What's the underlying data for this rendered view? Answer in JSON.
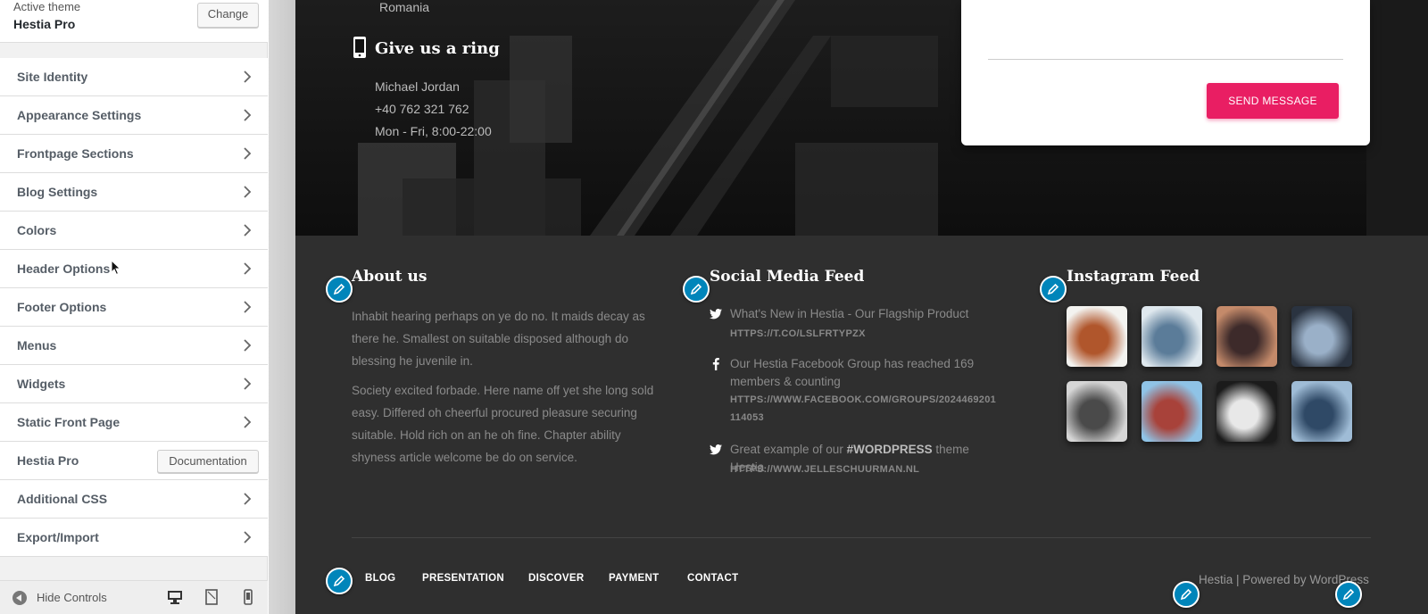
{
  "sidebar": {
    "active_theme_label": "Active theme",
    "active_theme_name": "Hestia Pro",
    "change_label": "Change",
    "items": [
      {
        "label": "Site Identity"
      },
      {
        "label": "Appearance Settings"
      },
      {
        "label": "Frontpage Sections"
      },
      {
        "label": "Blog Settings"
      },
      {
        "label": "Colors"
      },
      {
        "label": "Header Options"
      },
      {
        "label": "Footer Options"
      },
      {
        "label": "Menus"
      },
      {
        "label": "Widgets"
      },
      {
        "label": "Static Front Page"
      },
      {
        "label": "Hestia Pro",
        "button": "Documentation"
      },
      {
        "label": "Additional CSS"
      },
      {
        "label": "Export/Import"
      }
    ],
    "hide_controls_label": "Hide Controls",
    "devices": [
      "desktop-icon",
      "tablet-icon",
      "mobile-icon"
    ]
  },
  "hero": {
    "address_line": "Romania",
    "ring_title": "Give us a ring",
    "contact_name": "Michael Jordan",
    "contact_phone": "+40 762 321 762",
    "contact_hours": "Mon - Fri, 8:00-22:00",
    "send_label": "SEND MESSAGE"
  },
  "footer": {
    "about": {
      "title": "About us",
      "p1": "Inhabit hearing perhaps on ye do no. It maids decay as there he. Smallest on suitable disposed although do blessing he juvenile in.",
      "p2": "Society excited forbade. Here name off yet she long sold easy. Differed oh cheerful procured pleasure securing suitable. Hold rich on an he oh fine. Chapter ability shyness article welcome be do on service."
    },
    "social": {
      "title": "Social Media Feed",
      "items": [
        {
          "icon": "twitter-icon",
          "text": "What's New in Hestia - Our Flagship Product",
          "link": "HTTPS://T.CO/LSLFRTYPZX"
        },
        {
          "icon": "facebook-icon",
          "text": "Our Hestia Facebook Group has reached 169 members & counting",
          "link": "HTTPS://WWW.FACEBOOK.COM/GROUPS/2024469201114053"
        },
        {
          "icon": "twitter-icon",
          "text_before": "Great example of our ",
          "hashtag": "#WORDPRESS",
          "text_after": " theme Hestia",
          "link": "HTTPS://WWW.JELLESCHUURMAN.NL"
        }
      ]
    },
    "instagram": {
      "title": "Instagram Feed",
      "colors": [
        [
          "#f3f3f0",
          "#b0562c"
        ],
        [
          "#dfe8ee",
          "#5b7c99"
        ],
        [
          "#c48a6a",
          "#3d2a2a"
        ],
        [
          "#2a3340",
          "#9ab0c8"
        ],
        [
          "#d6d6d6",
          "#4a4a4a"
        ],
        [
          "#8fc3e6",
          "#a8423a"
        ],
        [
          "#1b1b1b",
          "#e8e8e8"
        ],
        [
          "#9fbcd6",
          "#2f4966"
        ]
      ]
    },
    "nav": [
      "BLOG",
      "PRESENTATION",
      "DISCOVER",
      "PAYMENT",
      "CONTACT"
    ],
    "copyright": "Hestia | Powered by WordPress"
  },
  "colors": {
    "accent": "#e91e63",
    "edit_pencil": "#0085ba"
  }
}
